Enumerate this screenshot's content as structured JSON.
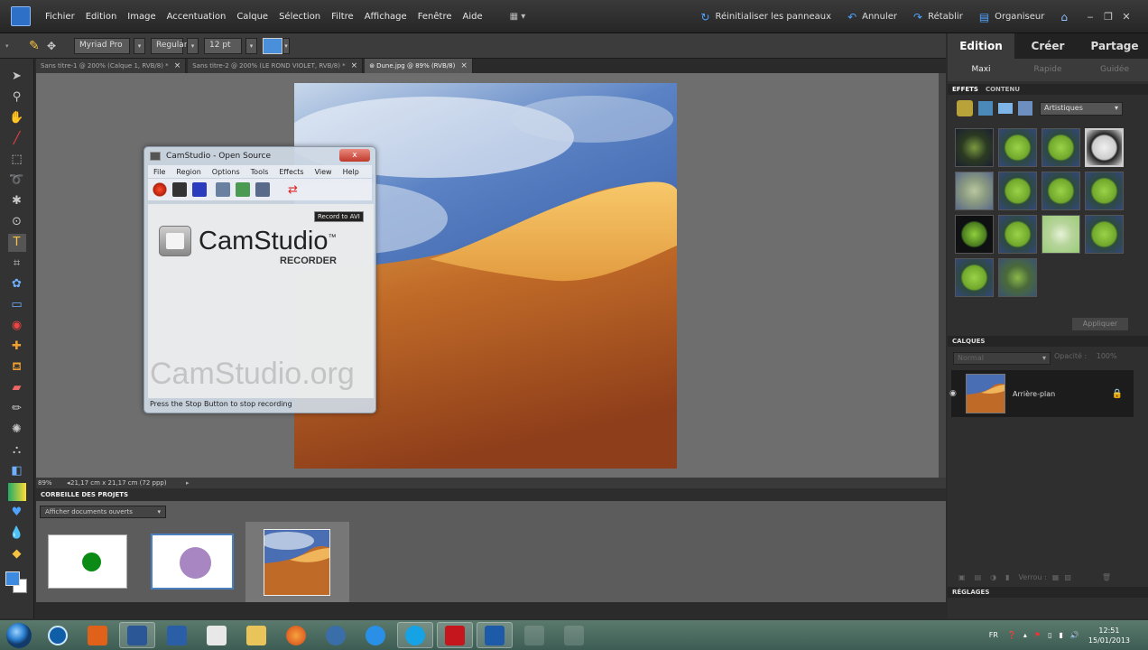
{
  "menubar": {
    "items": [
      "Fichier",
      "Edition",
      "Image",
      "Accentuation",
      "Calque",
      "Sélection",
      "Filtre",
      "Affichage",
      "Fenêtre",
      "Aide"
    ],
    "reset_panels": "Réinitialiser les panneaux",
    "undo": "Annuler",
    "redo": "Rétablir",
    "organizer": "Organiseur"
  },
  "options": {
    "font": "Myriad Pro",
    "style": "Regular",
    "size": "12 pt",
    "color": "#4a8fd9"
  },
  "tabs": [
    {
      "label": "Sans titre-1 @ 200% (Calque 1, RVB/8) *",
      "active": false
    },
    {
      "label": "Sans titre-2 @ 200% (LE ROND VIOLET, RVB/8) *",
      "active": false
    },
    {
      "label": "Dune.jpg @ 89% (RVB/8)",
      "active": true
    }
  ],
  "status": {
    "zoom": "89%",
    "doc_size": "21,17 cm x 21,17 cm (72 ppp)"
  },
  "bin": {
    "header": "CORBEILLE DES PROJETS",
    "filter": "Afficher documents ouverts"
  },
  "right_panel": {
    "modes": [
      "Edition",
      "Créer",
      "Partage"
    ],
    "subtabs": [
      "Maxi",
      "Rapide",
      "Guidée"
    ],
    "effects_tabs": [
      "EFFETS",
      "CONTENU"
    ],
    "effects_filter": "Artistiques",
    "apply": "Appliquer",
    "layers_header": "CALQUES",
    "blend_mode": "Normal",
    "opacity_label": "Opacité :",
    "opacity_value": "100%",
    "layer_name": "Arrière-plan",
    "lock_label": "Verrou :",
    "settings_header": "RÉGLAGES"
  },
  "camstudio": {
    "title": "CamStudio - Open Source",
    "close": "x",
    "menu": [
      "File",
      "Region",
      "Options",
      "Tools",
      "Effects",
      "View",
      "Help"
    ],
    "tooltip": "Record to AVI",
    "logo_text": "CamStudio",
    "logo_tm": "™",
    "logo_sub": "RECORDER",
    "watermark": "CamStudio.org",
    "status": "Press the Stop Button to stop recording"
  },
  "taskbar": {
    "language": "FR",
    "time": "12:51",
    "date": "15/01/2013"
  }
}
